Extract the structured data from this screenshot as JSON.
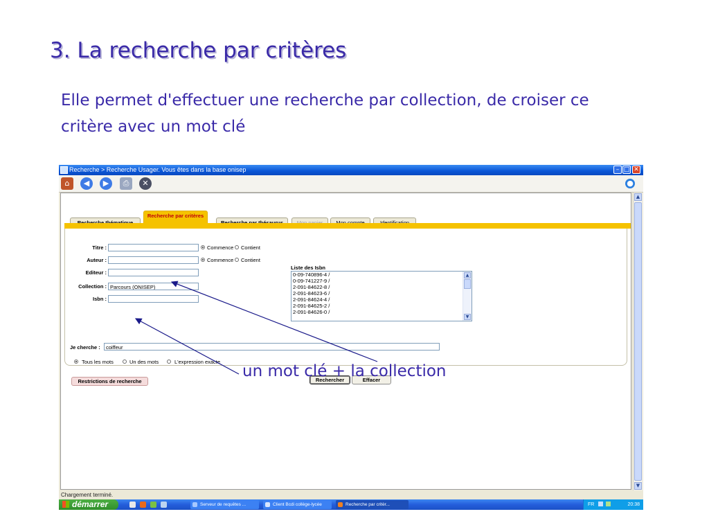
{
  "slide": {
    "title": "3. La recherche par critères",
    "text": "Elle permet d'effectuer une recherche par collection, de croiser ce critère avec un mot clé",
    "annotation": "un mot clé + la collection"
  },
  "window": {
    "title": "Recherche > Recherche Usager.  Vous êtes dans la base onisep",
    "status": "Chargement terminé."
  },
  "tabs": [
    {
      "label": "Recherche thématique"
    },
    {
      "label": "Recherche par critères"
    },
    {
      "label": "Recherche par thésaurus"
    },
    {
      "label": "Mon panier"
    },
    {
      "label": "Mon compte"
    },
    {
      "label": "Identification"
    }
  ],
  "form": {
    "titre_label": "Titre :",
    "titre_value": "",
    "auteur_label": "Auteur :",
    "auteur_value": "",
    "editeur_label": "Editeur :",
    "editeur_value": "",
    "collection_label": "Collection :",
    "collection_value": "Parcours (ONISEP)",
    "isbn_label": "Isbn :",
    "isbn_value": "",
    "commence": "Commence",
    "contient": "Contient",
    "je_cherche_label": "Je cherche :",
    "je_cherche_value": "coiffeur",
    "tous_les_mots": "Tous les mots",
    "un_des_mots": "Un des mots",
    "expression_exacte": "L'expression exacte",
    "restrictions_button": "Restrictions de recherche",
    "rechercher_button": "Rechercher",
    "effacer_button": "Effacer"
  },
  "isbn_list": {
    "title": "Liste des Isbn",
    "items": [
      "0-09-740896-4 /",
      "0-09-741227-9 /",
      "2-091-84622-8 /",
      "2-091-84623-6 /",
      "2-091-84624-4 /",
      "2-091-84625-2 /",
      "2-091-84626-0 /"
    ]
  },
  "taskbar": {
    "start": "démarrer",
    "tasks": [
      "Serveur de requêtes ...",
      "Client Bcdi collège-lycée",
      "Recherche par critèr..."
    ],
    "tray_lang": "FR",
    "clock": "20:38"
  },
  "colors": {
    "slide_text": "#3a2aa8",
    "tab_bar": "#f5c200",
    "active_tab_text": "#c0000a",
    "xp_blue": "#245edb"
  }
}
